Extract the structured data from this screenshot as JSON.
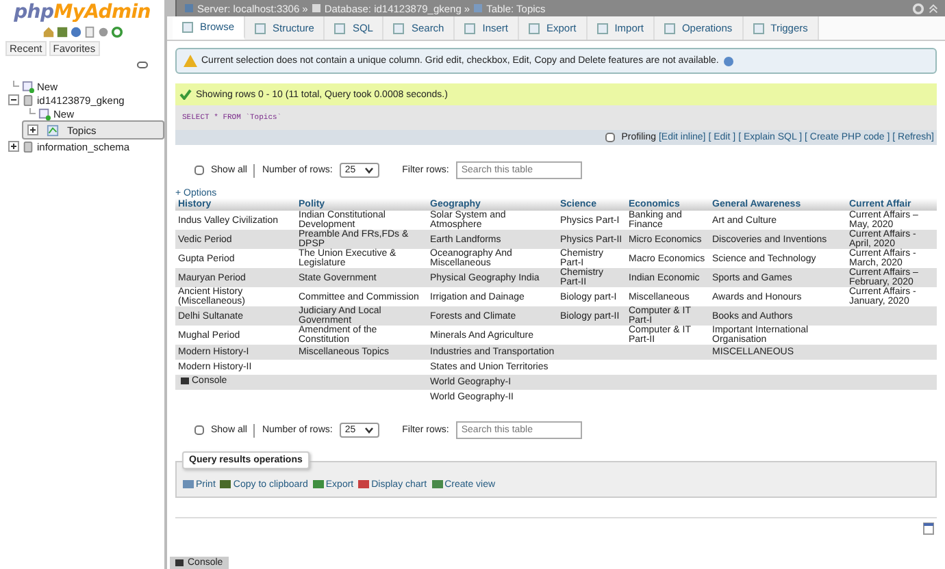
{
  "logo": {
    "part_1": "php",
    "part_2": "MyAdmin"
  },
  "sidebar": {
    "nav_tabs": [
      "Recent",
      "Favorites"
    ],
    "tree": [
      {
        "label": "New",
        "kind": "new",
        "selected": false
      },
      {
        "label": "id14123879_gkeng",
        "kind": "db",
        "expanded": true,
        "selected": false,
        "children": [
          {
            "label": "New",
            "kind": "new",
            "selected": false
          },
          {
            "label": "Topics",
            "kind": "table",
            "expanded": false,
            "selected": true
          }
        ]
      },
      {
        "label": "information_schema",
        "kind": "db",
        "expanded": false,
        "selected": false
      }
    ]
  },
  "breadcrumbs": [
    {
      "label": "Server: localhost:3306",
      "kind": "server",
      "separator": "»"
    },
    {
      "label": "Database: id14123879_gkeng",
      "kind": "db",
      "separator": "»"
    },
    {
      "label": "Table: Topics",
      "kind": "table"
    }
  ],
  "tabs": [
    {
      "label": "Browse",
      "selected": true
    },
    {
      "label": "Structure",
      "selected": false
    },
    {
      "label": "SQL",
      "selected": false
    },
    {
      "label": "Search",
      "selected": false
    },
    {
      "label": "Insert",
      "selected": false
    },
    {
      "label": "Export",
      "selected": false
    },
    {
      "label": "Import",
      "selected": false
    },
    {
      "label": "Operations",
      "selected": false
    },
    {
      "label": "Triggers",
      "selected": false
    }
  ],
  "notice": "Current selection does not contain a unique column. Grid edit, checkbox, Edit, Copy and Delete features are not available.",
  "success": "Showing rows 0 - 10 (11 total, Query took 0.0008 seconds.)",
  "sql": "SELECT * FROM `Topics`",
  "profiling": {
    "label": "Profiling",
    "checked": false,
    "links": [
      "[Edit inline]",
      "[ Edit ]",
      "[ Explain SQL ]",
      "[ Create PHP code ]",
      "[ Refresh]"
    ]
  },
  "nav_controls": [
    {
      "show_all": "Show all",
      "checked": false,
      "rows_label": "Number of rows:",
      "rows_value": "25",
      "filter_label": "Filter rows:",
      "placeholder": "Search this table"
    },
    {
      "show_all": "Show all",
      "checked": false,
      "rows_label": "Number of rows:",
      "rows_value": "25",
      "filter_label": "Filter rows:",
      "placeholder": "Search this table"
    }
  ],
  "options": "+ Options",
  "table": {
    "columns": [
      "History",
      "Polity",
      "Geography",
      "Science",
      "Economics",
      "General Awareness",
      "Current Affair"
    ],
    "rows": [
      [
        "Indus Valley Civilization",
        "Indian Constitutional Development",
        "Solar System and Atmosphere",
        "Physics Part-I",
        "Banking and Finance",
        "Art and Culture",
        "Current Affairs – May, 2020"
      ],
      [
        "Vedic Period",
        "Preamble And FRs,FDs & DPSP",
        "Earth Landforms",
        "Physics Part-II",
        "Micro Economics",
        "Discoveries and Inventions",
        "Current Affairs - April, 2020"
      ],
      [
        "Gupta Period",
        "The Union Executive & Legislature",
        "Oceanography And Miscellaneous",
        "Chemistry Part-I",
        "Macro Economics",
        "Science and Technology",
        "Current Affairs - March, 2020"
      ],
      [
        "Mauryan Period",
        "State Government",
        "Physical Geography India",
        "Chemistry Part-II",
        "Indian Economic",
        "Sports and Games",
        "Current Affairs – February, 2020"
      ],
      [
        "Ancient History (Miscellaneous)",
        "Committee and Commission",
        "Irrigation and Dainage",
        "Biology part-I",
        "Miscellaneous",
        "Awards and Honours",
        "Current Affairs - January, 2020"
      ],
      [
        "Delhi Sultanate",
        "Judiciary And Local Government",
        "Forests and Climate",
        "Biology part-II",
        "Computer & IT Part-I",
        "Books and Authors",
        ""
      ],
      [
        "Mughal Period",
        "Amendment of the Constitution",
        "Minerals And Agriculture",
        "",
        "Computer & IT Part-II",
        "Important International Organisation",
        ""
      ],
      [
        "Modern History-I",
        "Miscellaneous Topics",
        "Industries and Transportation",
        "",
        "",
        "MISCELLANEOUS",
        ""
      ],
      [
        "Modern History-II",
        "",
        "States and Union Territories",
        "",
        "",
        "",
        ""
      ],
      [
        "",
        "",
        "World Geography-I",
        "",
        "",
        "",
        ""
      ],
      [
        "",
        "",
        "World Geography-II",
        "",
        "",
        "",
        ""
      ]
    ]
  },
  "floating_console": "Console",
  "query_ops": {
    "title": "Query results operations",
    "actions": [
      {
        "label": "Print",
        "kind": "print"
      },
      {
        "label": "Copy to clipboard",
        "kind": "copy"
      },
      {
        "label": "Export",
        "kind": "export"
      },
      {
        "label": "Display chart",
        "kind": "chart"
      },
      {
        "label": "Create view",
        "kind": "view"
      }
    ]
  },
  "console": "Console"
}
